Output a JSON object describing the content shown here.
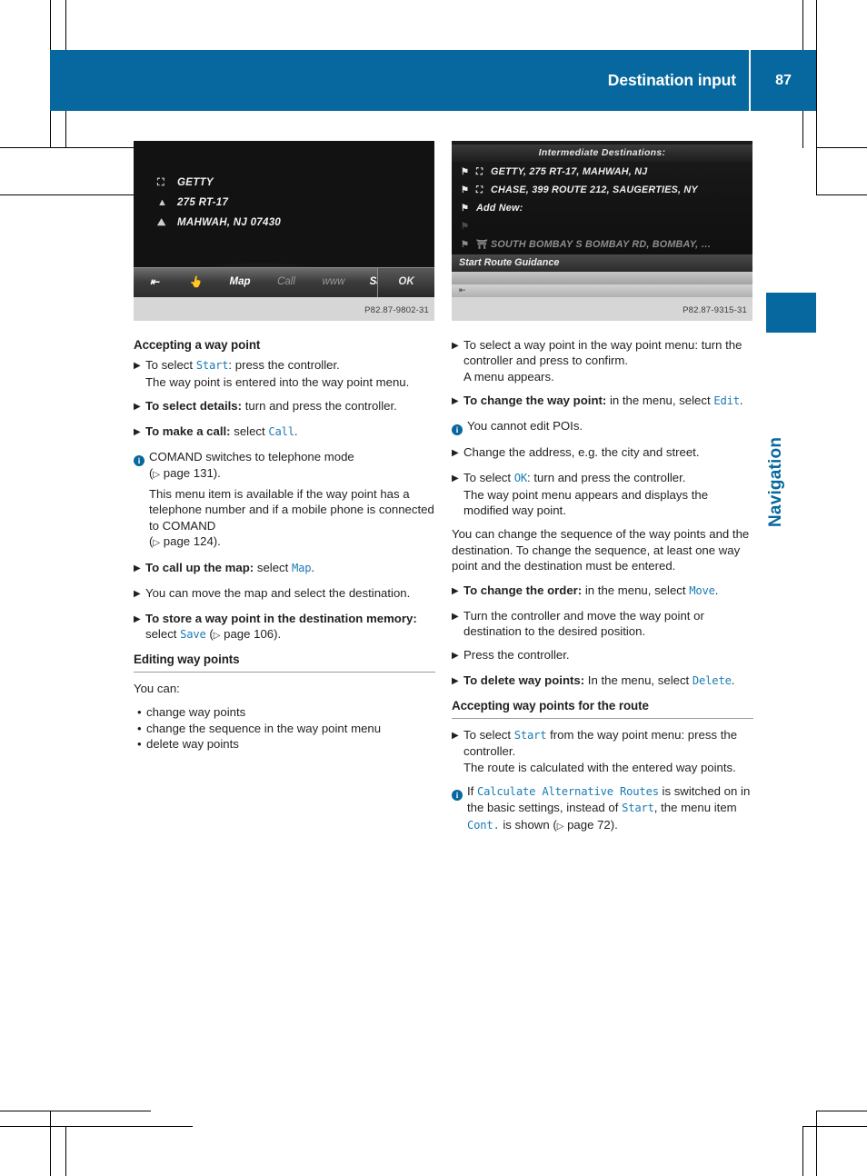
{
  "header": {
    "title": "Destination input",
    "page_number": "87"
  },
  "side_tab": {
    "label": "Navigation"
  },
  "figures": {
    "left": {
      "caption": "P82.87-9802-31",
      "rows": [
        {
          "icon": "fuel-pump-icon",
          "text": "GETTY"
        },
        {
          "icon": "street-icon",
          "text": "275 RT-17"
        },
        {
          "icon": "city-icon",
          "text": "MAHWAH, NJ 07430"
        }
      ],
      "toolbar": {
        "back_icon": "back-arrow-icon",
        "hand_icon": "pointer-icon",
        "map_label": "Map",
        "call_label": "Call",
        "www_label": "www",
        "save_label": "Save",
        "ok_label": "OK"
      }
    },
    "right": {
      "caption": "P82.87-9315-31",
      "title": "Intermediate Destinations:",
      "rows": [
        {
          "marker": "waypoint-flag-icon",
          "icon": "fuel-pump-icon",
          "text": "GETTY, 275 RT-17, MAHWAH, NJ"
        },
        {
          "marker": "waypoint-flag-icon",
          "icon": "bank-icon",
          "text": "CHASE, 399 ROUTE 212, SAUGERTIES, NY"
        },
        {
          "marker": "waypoint-flag-icon",
          "icon": "",
          "text": "Add New:"
        },
        {
          "marker": "waypoint-flag-icon",
          "icon": "",
          "text": ""
        },
        {
          "marker": "destination-flag-icon",
          "icon": "home-icon",
          "text": "SOUTH BOMBAY S BOMBAY RD, BOMBAY, …"
        }
      ],
      "guidance_label": "Start Route Guidance",
      "status_icon": "back-arrow-icon"
    }
  },
  "left_column": {
    "heading": "Accepting a way point",
    "steps": [
      {
        "lead": "To select ",
        "ui1": "Start",
        "after": ": press the controller.",
        "line2": "The way point is entered into the way point menu."
      },
      {
        "bold": "To select details:",
        "text": " turn and press the controller."
      },
      {
        "bold": "To make a call:",
        "text": " select ",
        "ui1": "Call",
        "after": "."
      }
    ],
    "info1": {
      "line1": "COMAND switches to telephone mode",
      "ref1_mark": "▷",
      "ref1": " page 131).",
      "para": "This menu item is available if the way point has a telephone number and if a mobile phone is connected to COMAND",
      "ref2": " page 124)."
    },
    "steps2": [
      {
        "bold": "To call up the map:",
        "text": " select ",
        "ui1": "Map",
        "after": "."
      },
      {
        "text": "You can move the map and select the destination."
      },
      {
        "bold": "To store a way point in the destination memory:",
        "text": " select ",
        "ui1": "Save",
        "after": " (",
        "ref": " page 106)."
      }
    ],
    "heading2": "Editing way points",
    "lead_text": "You can:",
    "bullets": [
      "change way points",
      "change the sequence in the way point menu",
      "delete way points"
    ]
  },
  "right_column": {
    "steps": [
      {
        "text": "To select a way point in the way point menu: turn the controller and press to confirm.",
        "line2": "A menu appears."
      },
      {
        "bold": "To change the way point:",
        "text": " in the menu, select ",
        "ui1": "Edit",
        "after": "."
      }
    ],
    "info1": {
      "text": "You cannot edit POIs."
    },
    "steps2": [
      {
        "text": "Change the address, e.g. the city and street."
      },
      {
        "lead": "To select ",
        "ui1": "OK",
        "after": ": turn and press the controller.",
        "line2": "The way point menu appears and displays the modified way point."
      }
    ],
    "para1": "You can change the sequence of the way points and the destination. To change the sequence, at least one way point and the destination must be entered.",
    "steps3": [
      {
        "bold": "To change the order:",
        "text": " in the menu, select ",
        "ui1": "Move",
        "after": "."
      },
      {
        "text": "Turn the controller and move the way point or destination to the desired position."
      },
      {
        "text": "Press the controller."
      },
      {
        "bold": "To delete way points:",
        "text": " In the menu, select ",
        "ui1": "Delete",
        "after": "."
      }
    ],
    "heading2": "Accepting way points for the route",
    "steps4": [
      {
        "lead": "To select ",
        "ui1": "Start",
        "after": " from the way point menu: press the controller.",
        "line2": "The route is calculated with the entered way points."
      }
    ],
    "info2": {
      "lead": "If ",
      "ui1": "Calculate Alternative Routes",
      "mid": " is switched on in the basic settings, instead of ",
      "ui2": "Start",
      "mid2": ", the menu item ",
      "ui3": "Cont.",
      "after": " is shown (",
      "ref": " page 72)."
    }
  },
  "colors": {
    "brand_blue": "#06689f",
    "ui_term_blue": "#1b7cb5",
    "text": "#231f20"
  }
}
